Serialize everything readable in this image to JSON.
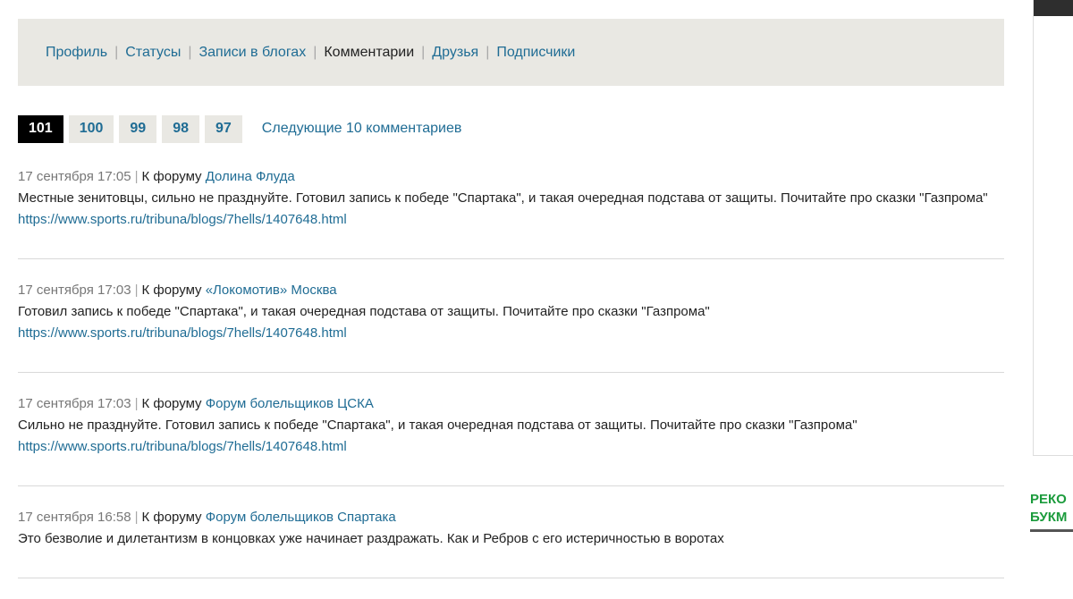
{
  "profile_nav": {
    "items": [
      {
        "label": "Профиль",
        "active": false
      },
      {
        "label": "Статусы",
        "active": false
      },
      {
        "label": "Записи в блогах",
        "active": false
      },
      {
        "label": "Комментарии",
        "active": true
      },
      {
        "label": "Друзья",
        "active": false
      },
      {
        "label": "Подписчики",
        "active": false
      }
    ],
    "separator": "|"
  },
  "pagination": {
    "pages": [
      "101",
      "100",
      "99",
      "98",
      "97"
    ],
    "current": "101",
    "next_label": "Следующие 10 комментариев"
  },
  "comments": [
    {
      "date": "17 сентября 17:05",
      "forum_prefix": "К форуму",
      "forum_name": "Долина Флуда",
      "text": "Местные зенитовцы, сильно не празднуйте. Готовил запись к победе \"Спартака\", и такая очередная подстава от защиты. Почитайте про сказки \"Газпрома\" ",
      "url": "https://www.sports.ru/tribuna/blogs/7hells/1407648.html"
    },
    {
      "date": "17 сентября 17:03",
      "forum_prefix": "К форуму",
      "forum_name": "«Локомотив» Москва",
      "text": "Готовил запись к победе \"Спартака\", и такая очередная подстава от защиты. Почитайте про сказки \"Газпрома\" ",
      "url": "https://www.sports.ru/tribuna/blogs/7hells/1407648.html"
    },
    {
      "date": "17 сентября 17:03",
      "forum_prefix": "К форуму",
      "forum_name": "Форум болельщиков ЦСКА",
      "text": "Сильно не празднуйте. Готовил запись к победе \"Спартака\", и такая очередная подстава от защиты. Почитайте про сказки \"Газпрома\" ",
      "url": "https://www.sports.ru/tribuna/blogs/7hells/1407648.html"
    },
    {
      "date": "17 сентября 16:58",
      "forum_prefix": "К форуму",
      "forum_name": "Форум болельщиков Спартака",
      "text": "Это безволие и дилетантизм в концовках уже начинает раздражать. Как и Ребров с его истеричностью в воротах",
      "url": ""
    }
  ],
  "sidebar": {
    "heading": "РЕКО\nБУКМ"
  }
}
